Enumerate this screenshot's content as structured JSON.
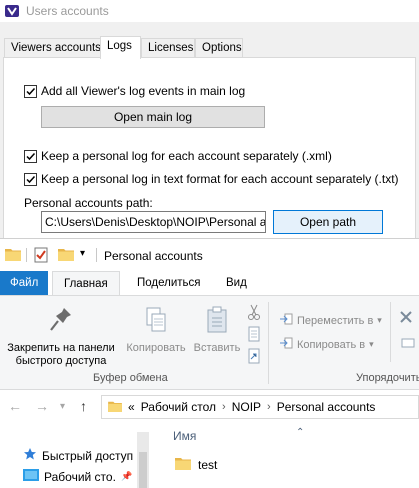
{
  "dialog": {
    "title": "Users accounts",
    "tabs": [
      {
        "label": "Viewers accounts"
      },
      {
        "label": "Logs"
      },
      {
        "label": "Licenses"
      },
      {
        "label": "Options"
      }
    ],
    "active_tab": "Logs",
    "add_all_log_events": {
      "label": "Add all Viewer's log events in main log",
      "checked": true
    },
    "open_main_log_button": "Open main log",
    "personal_log_xml": {
      "label": "Keep a personal log for each account separately (.xml)",
      "checked": true
    },
    "personal_log_txt": {
      "label": "Keep a personal log in text format for each account separately (.txt)",
      "checked": true
    },
    "path_label": "Personal accounts path:",
    "path_value": "C:\\Users\\Denis\\Desktop\\NOIP\\Personal accou",
    "open_path_button": "Open path"
  },
  "explorer": {
    "title": "Personal accounts",
    "ribbon_tabs": {
      "file": "Файл",
      "home": "Главная",
      "share": "Поделиться",
      "view": "Вид"
    },
    "ribbon": {
      "pin_label_1": "Закрепить на панели",
      "pin_label_2": "быстрого доступа",
      "copy": "Копировать",
      "paste": "Вставить",
      "clipboard_group": "Буфер обмена",
      "move_to": "Переместить в",
      "copy_to": "Копировать в",
      "organize_group": "Упорядочить"
    },
    "address": {
      "overflow": "«",
      "crumbs": [
        "Рабочий стол",
        "NOIP",
        "Personal accounts"
      ]
    },
    "nav": [
      {
        "label": "Быстрый доступ"
      },
      {
        "label": "Рабочий сто."
      }
    ],
    "column_header": "Имя",
    "files": [
      {
        "name": "test"
      }
    ]
  }
}
